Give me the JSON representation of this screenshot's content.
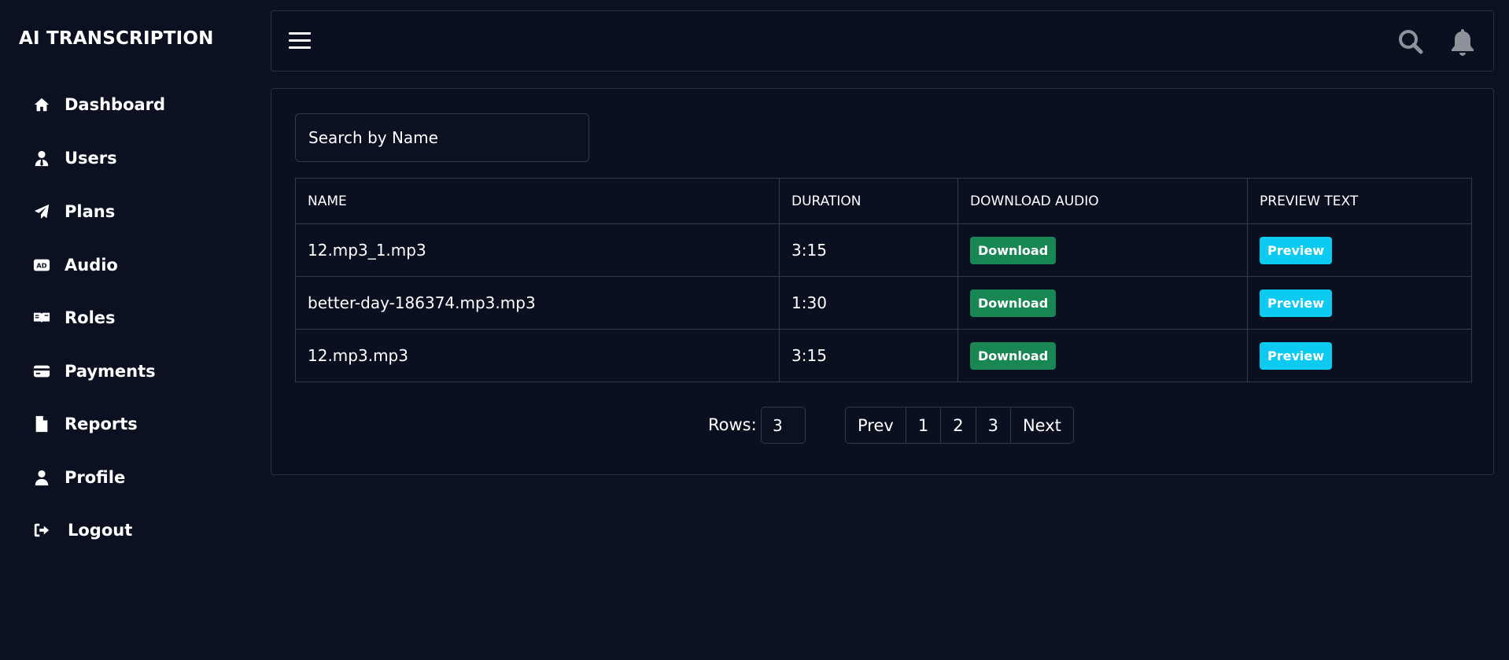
{
  "brand": "AI TRANSCRIPTION",
  "sidebar": {
    "items": [
      {
        "label": "Dashboard",
        "icon": "home-icon"
      },
      {
        "label": "Users",
        "icon": "user-tie-icon"
      },
      {
        "label": "Plans",
        "icon": "paper-plane-icon"
      },
      {
        "label": "Audio",
        "icon": "audio-description-icon"
      },
      {
        "label": "Roles",
        "icon": "book-reader-icon"
      },
      {
        "label": "Payments",
        "icon": "credit-card-icon"
      },
      {
        "label": "Reports",
        "icon": "file-icon"
      },
      {
        "label": "Profile",
        "icon": "user-icon"
      },
      {
        "label": "Logout",
        "icon": "sign-out-icon"
      }
    ]
  },
  "topbar": {
    "icons": [
      "hamburger-icon",
      "search-icon",
      "bell-icon"
    ]
  },
  "search": {
    "placeholder": "Search by Name"
  },
  "table": {
    "headers": [
      "NAME",
      "DURATION",
      "DOWNLOAD AUDIO",
      "PREVIEW TEXT"
    ],
    "rows": [
      {
        "name": "12.mp3_1.mp3",
        "duration": "3:15",
        "download": "Download",
        "preview": "Preview"
      },
      {
        "name": "better-day-186374.mp3.mp3",
        "duration": "1:30",
        "download": "Download",
        "preview": "Preview"
      },
      {
        "name": "12.mp3.mp3",
        "duration": "3:15",
        "download": "Download",
        "preview": "Preview"
      }
    ]
  },
  "pagination": {
    "rows_label": "Rows:",
    "rows_value": "3",
    "prev": "Prev",
    "pages": [
      "1",
      "2",
      "3"
    ],
    "next": "Next"
  },
  "colors": {
    "background": "#0b1120",
    "download_button": "#198754",
    "preview_button": "#0dcaf0",
    "border": "#2e3a4e"
  }
}
